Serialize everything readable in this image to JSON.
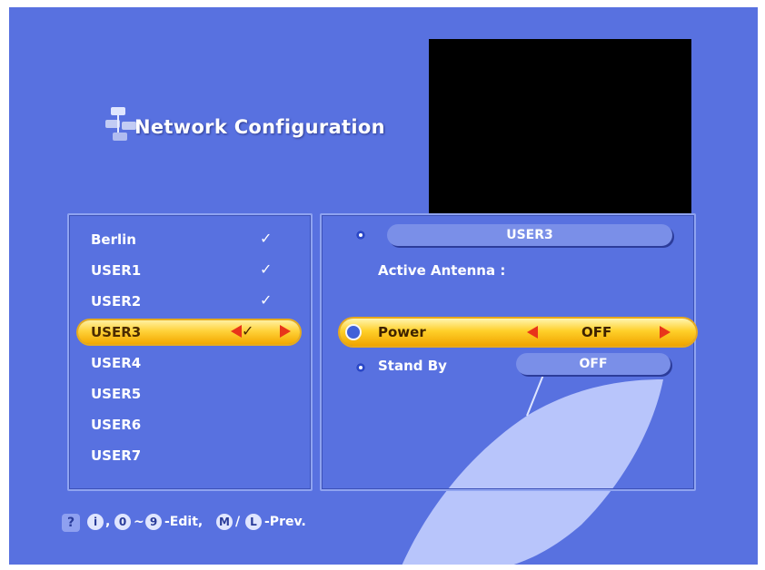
{
  "title": "Network Configuration",
  "users": [
    {
      "name": "Berlin",
      "checked": true
    },
    {
      "name": "USER1",
      "checked": true
    },
    {
      "name": "USER2",
      "checked": true
    },
    {
      "name": "USER3",
      "checked": true,
      "selected": true
    },
    {
      "name": "USER4",
      "checked": false
    },
    {
      "name": "USER5",
      "checked": false
    },
    {
      "name": "USER6",
      "checked": false
    },
    {
      "name": "USER7",
      "checked": false
    }
  ],
  "check_symbol": "✓",
  "detail": {
    "selected_user": "USER3",
    "active_antenna_label": "Active Antenna :",
    "power_label": "Power",
    "power_value": "OFF",
    "standby_label": "Stand By",
    "standby_value": "OFF"
  },
  "footer": {
    "help_icon": "?",
    "info_key": "i",
    "zero_key": "0",
    "tilde": "~",
    "nine_key": "9",
    "edit_text": "-Edit,",
    "m_key": "M",
    "slash": "/",
    "l_key": "L",
    "prev_text": "-Prev."
  },
  "colors": {
    "background": "#5871e0",
    "highlight": "#ffd23a",
    "arrow": "#e8341a"
  }
}
